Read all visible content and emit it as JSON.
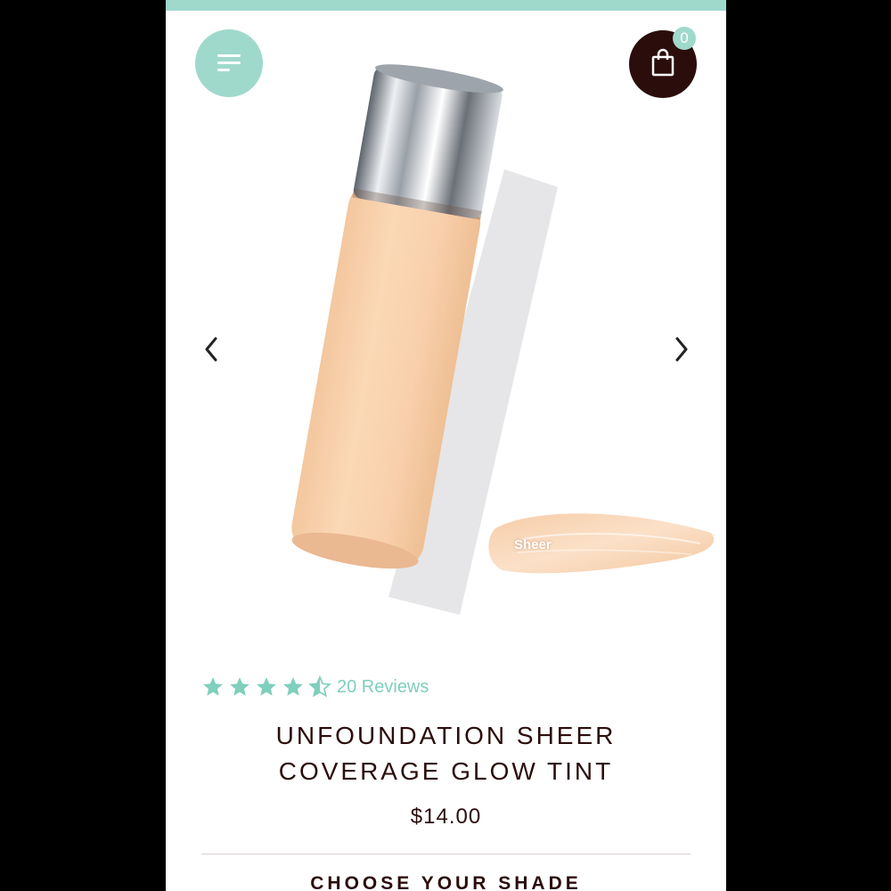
{
  "header": {
    "menu_icon": "menu-lines-icon",
    "cart_icon": "shopping-bag-icon",
    "cart_count": "0",
    "accent_color": "#9fd9cc",
    "brand_dark": "#2b0d0b"
  },
  "gallery": {
    "prev_icon": "chevron-left-icon",
    "next_icon": "chevron-right-icon",
    "swatch_label": "Sheer",
    "product_colors": {
      "tint": "#f8d3b0",
      "cap": "#c9cdd3"
    }
  },
  "product": {
    "rating": 4.5,
    "reviews_label": "20 Reviews",
    "title_line1": "UNFOUNDATION SHEER",
    "title_line2": "COVERAGE GLOW TINT",
    "price": "$14.00",
    "shade_heading": "CHOOSE YOUR SHADE"
  }
}
